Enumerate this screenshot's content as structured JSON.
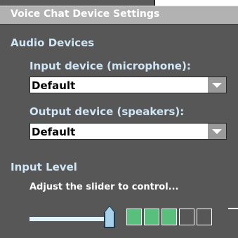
{
  "window": {
    "title": "Voice Chat Device Settings"
  },
  "audio_devices": {
    "section_label": "Audio Devices",
    "input": {
      "label": "Input device (microphone):",
      "selected": "Default"
    },
    "output": {
      "label": "Output device (speakers):",
      "selected": "Default"
    }
  },
  "input_level": {
    "section_label": "Input Level",
    "hint": "Adjust the slider to control...",
    "slider_fraction": 0.95,
    "meter": {
      "lit_cells": 3,
      "total_cells": 5,
      "lit_color": "#58c07c"
    }
  },
  "colors": {
    "panel_bg": "#575757",
    "title_bar": "#b2b2b2",
    "section_text": "#cfe6f5"
  }
}
